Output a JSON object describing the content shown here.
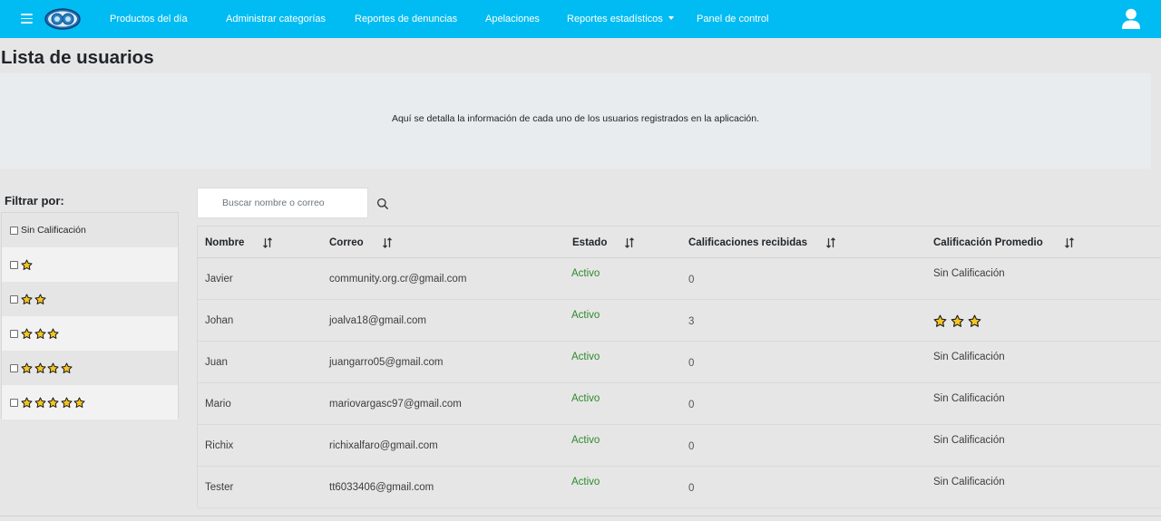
{
  "navbar": {
    "menu_icon": "hamburger-menu-icon",
    "logo": "app-logo",
    "items": [
      {
        "label": "Productos del día"
      },
      {
        "label": "Administrar categorías"
      },
      {
        "label": "Reportes de denuncias"
      },
      {
        "label": "Apelaciones"
      },
      {
        "label": "Reportes estadísticos",
        "dropdown": true
      },
      {
        "label": "Panel de control"
      }
    ],
    "user_icon": "user-icon",
    "color": "#00bcf2"
  },
  "page": {
    "title": "Lista de usuarios",
    "description": "Aquí se detalla la información de cada uno de los usuarios registrados en la aplicación."
  },
  "filter": {
    "title": "Filtrar por:",
    "options": [
      {
        "label": "Sin Calificación",
        "stars": 0,
        "checked": false
      },
      {
        "label": "",
        "stars": 1,
        "checked": false
      },
      {
        "label": "",
        "stars": 2,
        "checked": false
      },
      {
        "label": "",
        "stars": 3,
        "checked": false
      },
      {
        "label": "",
        "stars": 4,
        "checked": false
      },
      {
        "label": "",
        "stars": 5,
        "checked": false
      }
    ]
  },
  "search": {
    "placeholder": "Buscar nombre o correo",
    "value": "",
    "icon": "search-icon"
  },
  "table": {
    "columns": [
      "Nombre",
      "Correo",
      "Estado",
      "Calificaciones recibidas",
      "Calificación Promedio"
    ],
    "sort_icon": "sort-icon",
    "rows": [
      {
        "nombre": "Javier",
        "correo": "community.org.cr@gmail.com",
        "estado": "Activo",
        "calificaciones": "0",
        "promedio": "Sin Calificación",
        "promedio_stars": 0
      },
      {
        "nombre": "Johan",
        "correo": "joalva18@gmail.com",
        "estado": "Activo",
        "calificaciones": "3",
        "promedio": "",
        "promedio_stars": 3
      },
      {
        "nombre": "Juan",
        "correo": "juangarro05@gmail.com",
        "estado": "Activo",
        "calificaciones": "0",
        "promedio": "Sin Calificación",
        "promedio_stars": 0
      },
      {
        "nombre": "Mario",
        "correo": "mariovargasc97@gmail.com",
        "estado": "Activo",
        "calificaciones": "0",
        "promedio": "Sin Calificación",
        "promedio_stars": 0
      },
      {
        "nombre": "Richix",
        "correo": "richixalfaro@gmail.com",
        "estado": "Activo",
        "calificaciones": "0",
        "promedio": "Sin Calificación",
        "promedio_stars": 0
      },
      {
        "nombre": "Tester",
        "correo": "tt6033406@gmail.com",
        "estado": "Activo",
        "calificaciones": "0",
        "promedio": "Sin Calificación",
        "promedio_stars": 0
      }
    ]
  },
  "colors": {
    "active_status": "#2d8a2d",
    "star_fill": "#f6c51f"
  }
}
